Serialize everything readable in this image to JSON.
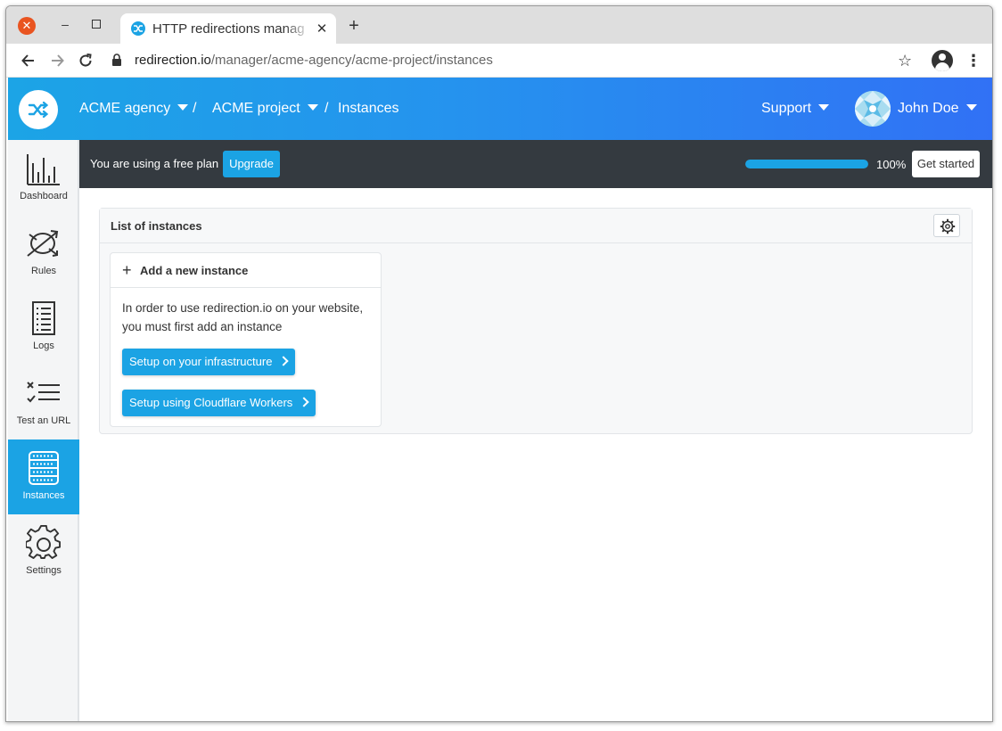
{
  "browser": {
    "tab_title": "HTTP redirections manag",
    "tab_close": "✕",
    "new_tab": "+",
    "url_host": "redirection.io",
    "url_path": "/manager/acme-agency/acme-project/instances",
    "window_close": "✕",
    "window_min": "–"
  },
  "header": {
    "org": "ACME agency",
    "separator": "/",
    "project": "ACME project",
    "page": "Instances",
    "support": "Support",
    "user": "John Doe"
  },
  "sidebar": {
    "items": [
      {
        "label": "Dashboard",
        "icon": "chart-icon"
      },
      {
        "label": "Rules",
        "icon": "rules-icon"
      },
      {
        "label": "Logs",
        "icon": "logs-icon"
      },
      {
        "label": "Test an URL",
        "icon": "test-icon"
      },
      {
        "label": "Instances",
        "icon": "server-icon",
        "active": true
      },
      {
        "label": "Settings",
        "icon": "gear-icon"
      }
    ]
  },
  "planbar": {
    "text": "You are using a free plan",
    "upgrade": "Upgrade",
    "progress_percent": 100,
    "progress_label": "100%",
    "get_started": "Get started"
  },
  "main": {
    "card_title": "List of instances",
    "add_instance": {
      "plus": "+",
      "title": "Add a new instance",
      "text": "In order to use redirection.io on your website, you must first add an instance",
      "setup_infra": "Setup on your infrastructure",
      "setup_cloudflare": "Setup using Cloudflare Workers"
    }
  },
  "colors": {
    "accent": "#1ba3e4",
    "header_gradient_start": "#1ca4e6",
    "header_gradient_end": "#3171f5",
    "planbar_bg": "#343a40"
  }
}
